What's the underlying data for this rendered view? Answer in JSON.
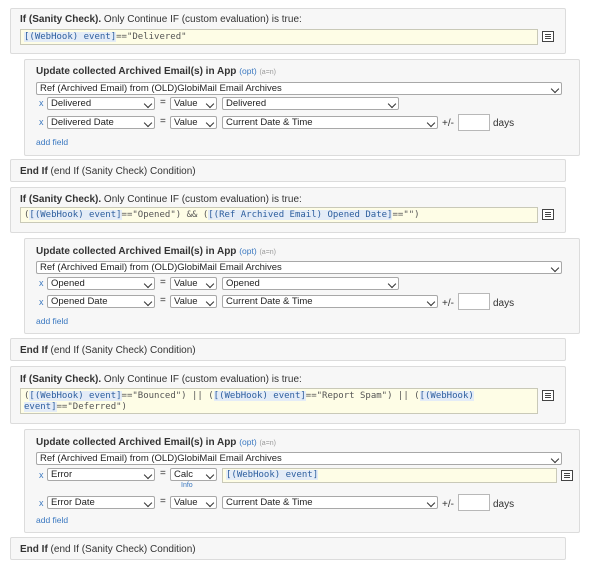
{
  "blocks": {
    "if1": {
      "label": "If (Sanity Check).",
      "rest": " Only Continue IF (custom evaluation) is true:",
      "expr": [
        {
          "t": "[(WebHook) event]",
          "v": true
        },
        {
          "t": "==\"Delivered\"",
          "v": false
        }
      ]
    },
    "upd1": {
      "title": "Update collected Archived Email(s) in App",
      "opt": "(opt)",
      "anno": "(a=n)",
      "source": "Ref (Archived Email) from (OLD)GlobiMail Email Archives",
      "rows": [
        {
          "x": "x",
          "field": "Delivered",
          "eq": "=",
          "mode": "Value",
          "value": "Delivered"
        },
        {
          "x": "x",
          "field": "Delivered Date",
          "eq": "=",
          "mode": "Value",
          "value": "Current Date & Time",
          "pm": "+/-",
          "days": "days"
        }
      ],
      "add": "add field"
    },
    "end1": {
      "label": "End If",
      "rest": " (end If (Sanity Check) Condition)"
    },
    "if2": {
      "label": "If (Sanity Check).",
      "rest": " Only Continue IF (custom evaluation) is true:",
      "expr": [
        {
          "t": "(",
          "v": false
        },
        {
          "t": "[(WebHook) event]",
          "v": true
        },
        {
          "t": "==\"Opened\") && (",
          "v": false
        },
        {
          "t": "[(Ref Archived Email) Opened Date]",
          "v": true
        },
        {
          "t": "==\"\")",
          "v": false
        }
      ]
    },
    "upd2": {
      "title": "Update collected Archived Email(s) in App",
      "opt": "(opt)",
      "anno": "(a=n)",
      "source": "Ref (Archived Email) from (OLD)GlobiMail Email Archives",
      "rows": [
        {
          "x": "x",
          "field": "Opened",
          "eq": "=",
          "mode": "Value",
          "value": "Opened"
        },
        {
          "x": "x",
          "field": "Opened Date",
          "eq": "=",
          "mode": "Value",
          "value": "Current Date & Time",
          "pm": "+/-",
          "days": "days"
        }
      ],
      "add": "add field"
    },
    "end2": {
      "label": "End If",
      "rest": " (end If (Sanity Check) Condition)"
    },
    "if3": {
      "label": "If (Sanity Check).",
      "rest": " Only Continue IF (custom evaluation) is true:",
      "expr_line1": [
        {
          "t": "(",
          "v": false
        },
        {
          "t": "[(WebHook) event]",
          "v": true
        },
        {
          "t": "==\"Bounced\") || (",
          "v": false
        },
        {
          "t": "[(WebHook) event]",
          "v": true
        },
        {
          "t": "==\"Report Spam\") || (",
          "v": false
        },
        {
          "t": "[(WebHook)",
          "v": true
        }
      ],
      "expr_line2": [
        {
          "t": "event]",
          "v": true
        },
        {
          "t": "==\"Deferred\")",
          "v": false
        }
      ]
    },
    "upd3": {
      "title": "Update collected Archived Email(s) in App",
      "opt": "(opt)",
      "anno": "(a=n)",
      "source": "Ref (Archived Email) from (OLD)GlobiMail Email Archives",
      "rows": [
        {
          "x": "x",
          "field": "Error",
          "eq": "=",
          "mode": "Calc",
          "info": "Info",
          "calc": "[(WebHook) event]"
        },
        {
          "x": "x",
          "field": "Error Date",
          "eq": "=",
          "mode": "Value",
          "value": "Current Date & Time",
          "pm": "+/-",
          "days": "days"
        }
      ],
      "add": "add field"
    },
    "end3": {
      "label": "End If",
      "rest": " (end If (Sanity Check) Condition)"
    }
  },
  "icons": [
    "edit-expression-icon",
    "dropdown-chevron-icon",
    "remove-field-icon"
  ]
}
